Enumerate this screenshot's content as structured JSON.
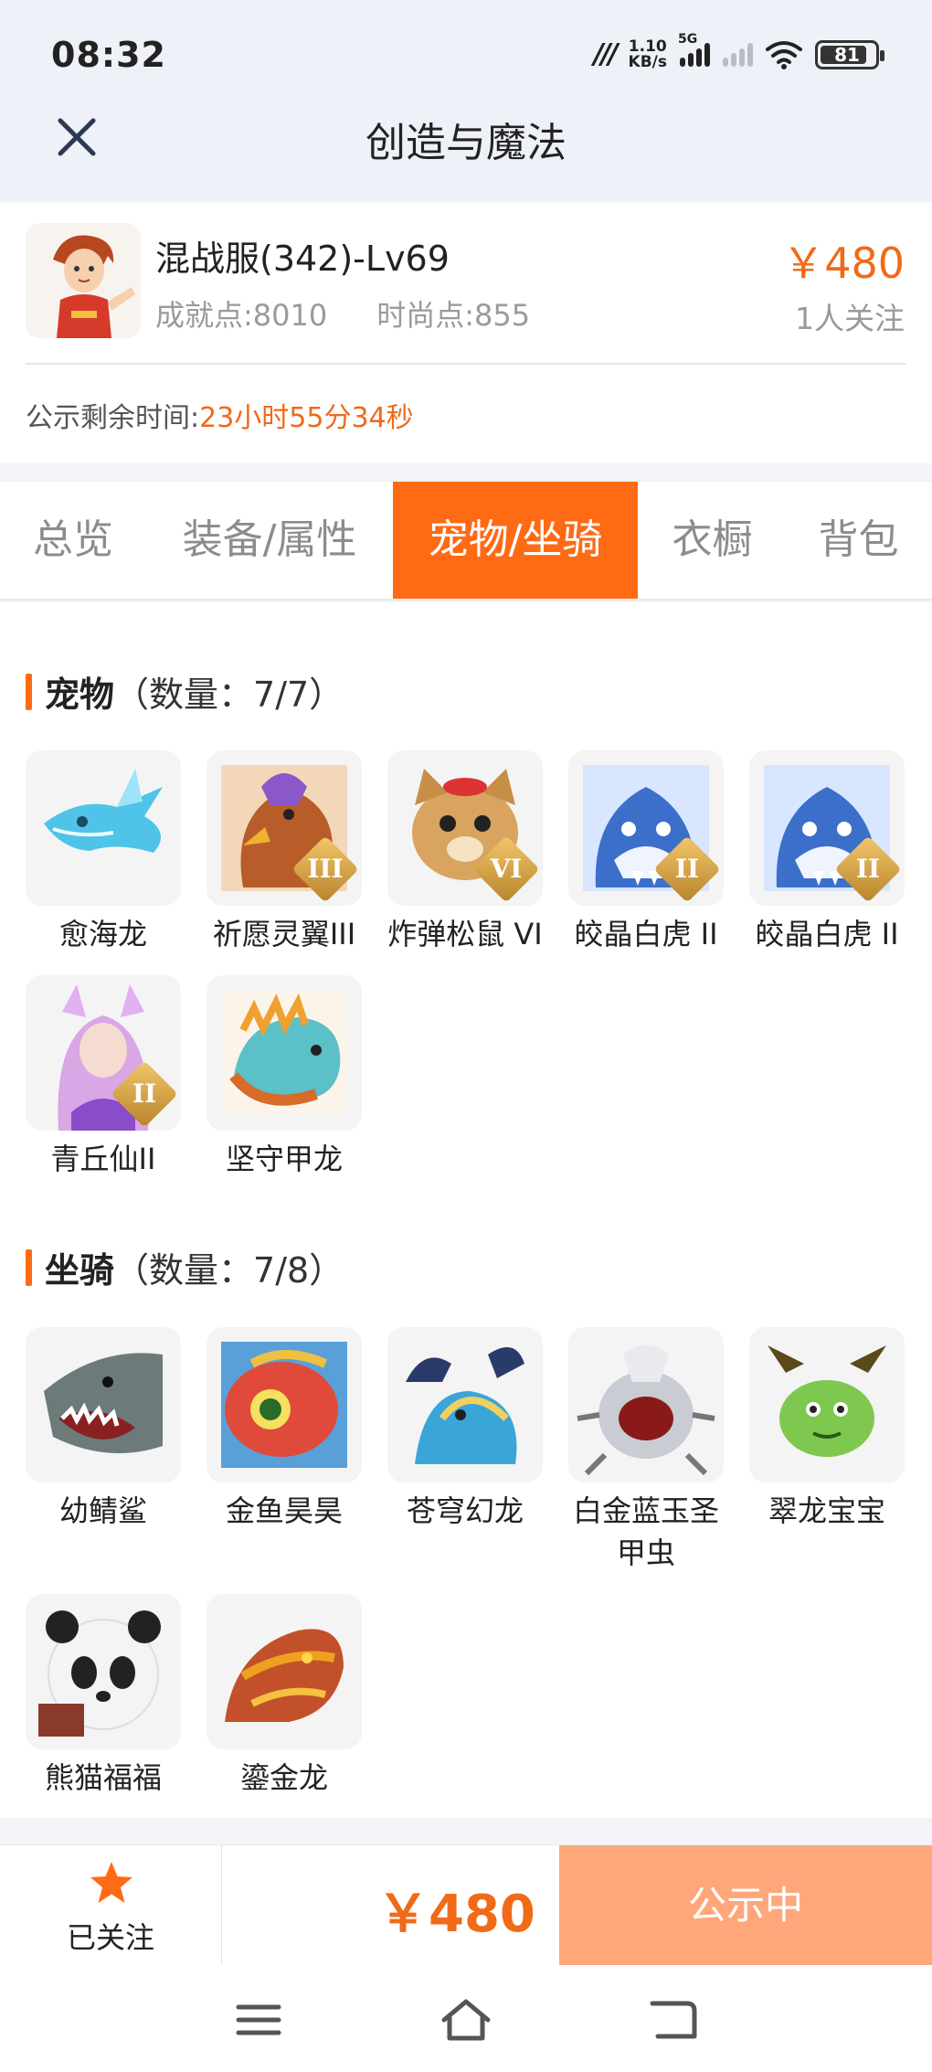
{
  "status_bar": {
    "time": "08:32",
    "net_speed_top": "1.10",
    "net_speed_unit": "KB/s",
    "signal_label": "5G",
    "battery": "81"
  },
  "header": {
    "title": "创造与魔法"
  },
  "account": {
    "name": "混战服(342)-Lv69",
    "achievement": "成就点:8010",
    "fashion": "时尚点:855",
    "price": "￥480",
    "followers": "1人关注",
    "countdown_label": "公示剩余时间:",
    "countdown_value": "23小时55分34秒"
  },
  "tabs": [
    {
      "label": "总览",
      "active": false
    },
    {
      "label": "装备/属性",
      "active": false
    },
    {
      "label": "宠物/坐骑",
      "active": true
    },
    {
      "label": "衣橱",
      "active": false
    },
    {
      "label": "背包",
      "active": false
    }
  ],
  "pets": {
    "title": "宠物",
    "count": "（数量：7/7）",
    "items": [
      {
        "name": "愈海龙",
        "rank": "",
        "icon": "blue-sea-dragon",
        "color": "#4fc3e8"
      },
      {
        "name": "祈愿灵翼III",
        "rank": "III",
        "icon": "eagle",
        "color": "#b85c2a"
      },
      {
        "name": "炸弹松鼠 VI",
        "rank": "VI",
        "icon": "squirrel",
        "color": "#d8a460"
      },
      {
        "name": "皎晶白虎 II",
        "rank": "II",
        "icon": "white-tiger",
        "color": "#3b6fc9"
      },
      {
        "name": "皎晶白虎 II",
        "rank": "II",
        "icon": "white-tiger",
        "color": "#3b6fc9"
      },
      {
        "name": "青丘仙II",
        "rank": "II",
        "icon": "fox-fairy",
        "color": "#d9a6e6"
      },
      {
        "name": "坚守甲龙",
        "rank": "",
        "icon": "armored-dragon",
        "color": "#5cc0c8"
      }
    ]
  },
  "mounts": {
    "title": "坐骑",
    "count": "（数量：7/8）",
    "items": [
      {
        "name": "幼鲭鲨",
        "icon": "shark",
        "color": "#6c7a7a"
      },
      {
        "name": "金鱼昊昊",
        "icon": "goldfish",
        "color": "#e04a3a"
      },
      {
        "name": "苍穹幻龙",
        "icon": "sky-dragon",
        "color": "#3aa6d8"
      },
      {
        "name": "白金蓝玉圣甲虫",
        "icon": "beetle",
        "color": "#c9ccd2"
      },
      {
        "name": "翠龙宝宝",
        "icon": "jade-dragon",
        "color": "#7fc850"
      },
      {
        "name": "熊猫福福",
        "icon": "panda",
        "color": "#333333"
      },
      {
        "name": "鎏金龙",
        "icon": "golden-dragon",
        "color": "#c2502a"
      }
    ]
  },
  "bottom": {
    "follow_label": "已关注",
    "price": "￥480",
    "status_button": "公示中"
  },
  "colors": {
    "accent": "#ff6a14",
    "price": "#f06a18",
    "status_button": "#ffa77a"
  }
}
